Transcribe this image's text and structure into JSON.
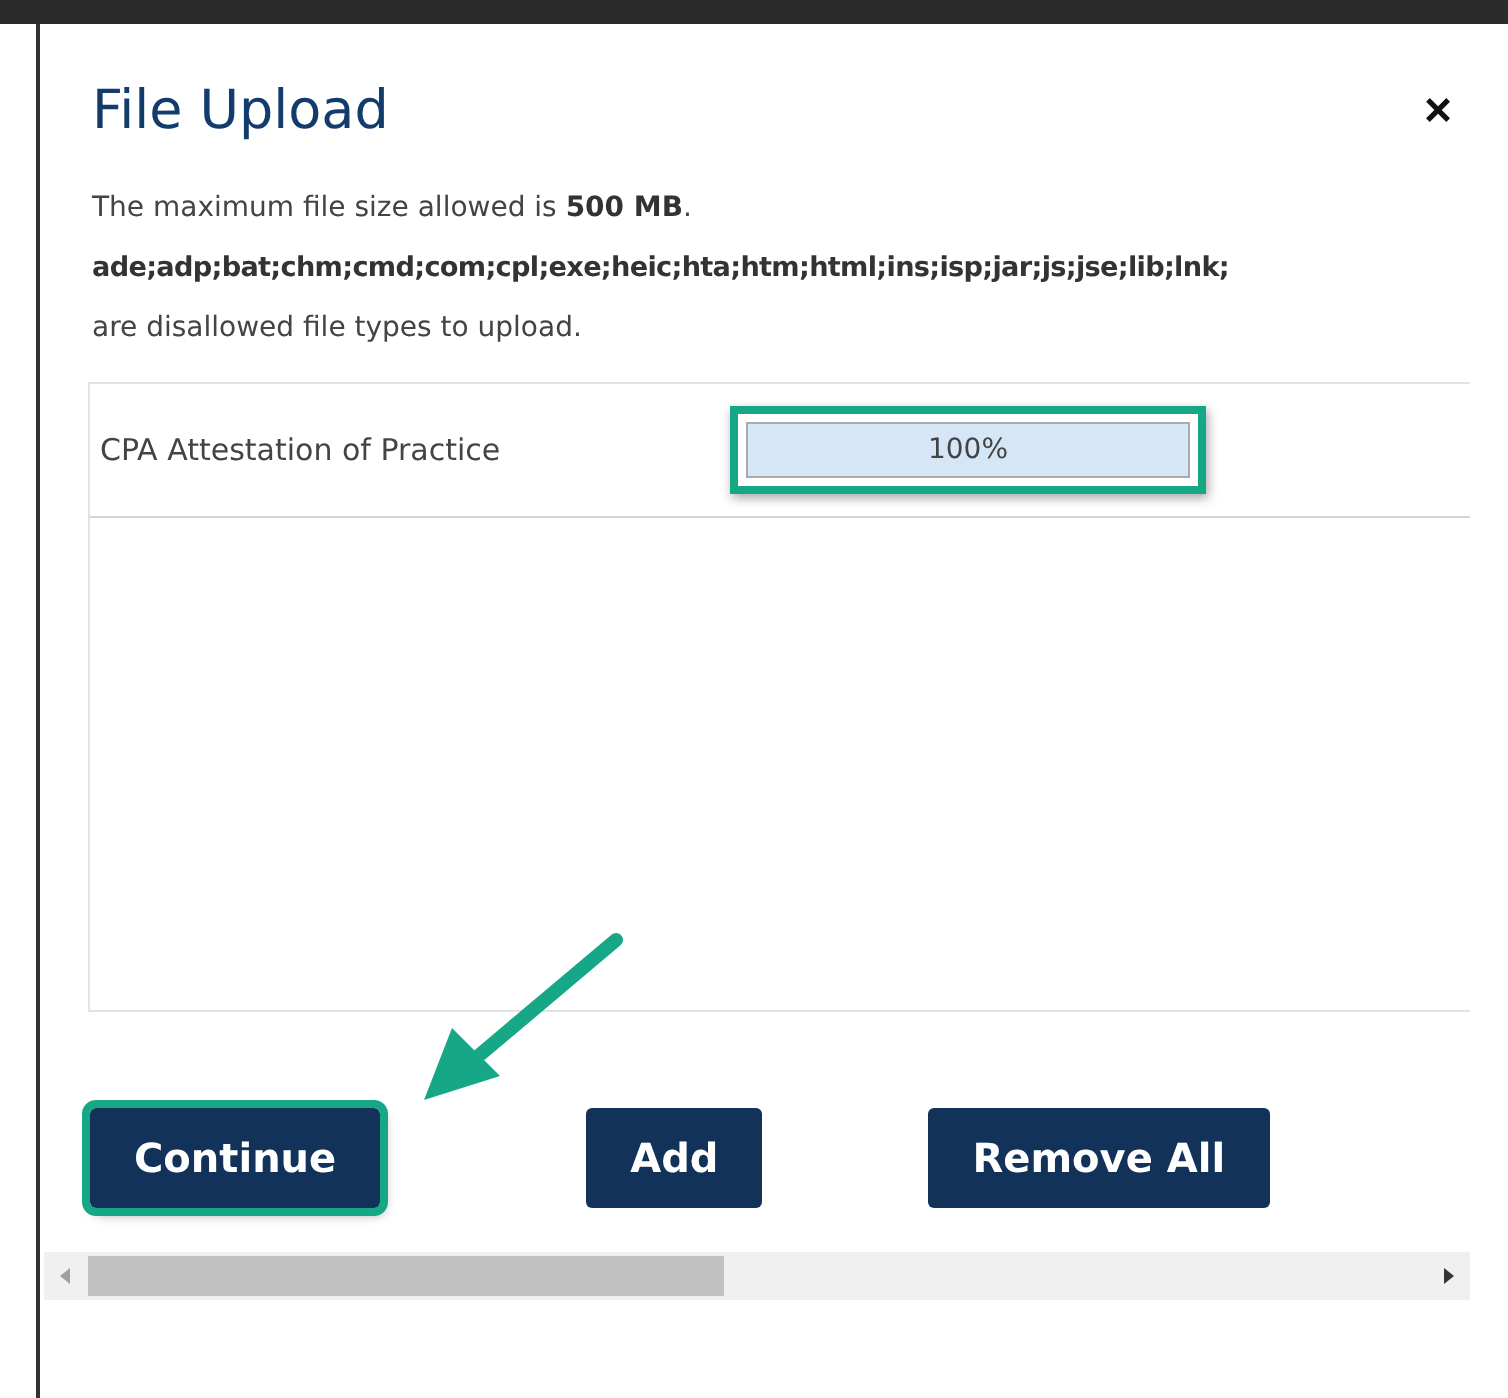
{
  "dialog": {
    "title": "File Upload",
    "close": "×"
  },
  "info": {
    "size_text": "The maximum file size allowed is **500 MB**.",
    "disallowed_types": "ade;adp;bat;chm;cmd;com;cpl;exe;heic;hta;htm;html;ins;isp;jar;js;jse;lib;lnk;",
    "disallowed_note": "are disallowed file types to upload."
  },
  "files": [
    {
      "name": "CPA Attestation of Practice",
      "level": 1,
      "reading": "100%",
      "highlighted": true
    }
  ],
  "buttons": [
    {
      "label": "Continue",
      "highlighted": true
    },
    {
      "label": "Add",
      "highlighted": false
    },
    {
      "label": "Remove All",
      "highlighted": false
    }
  ]
}
